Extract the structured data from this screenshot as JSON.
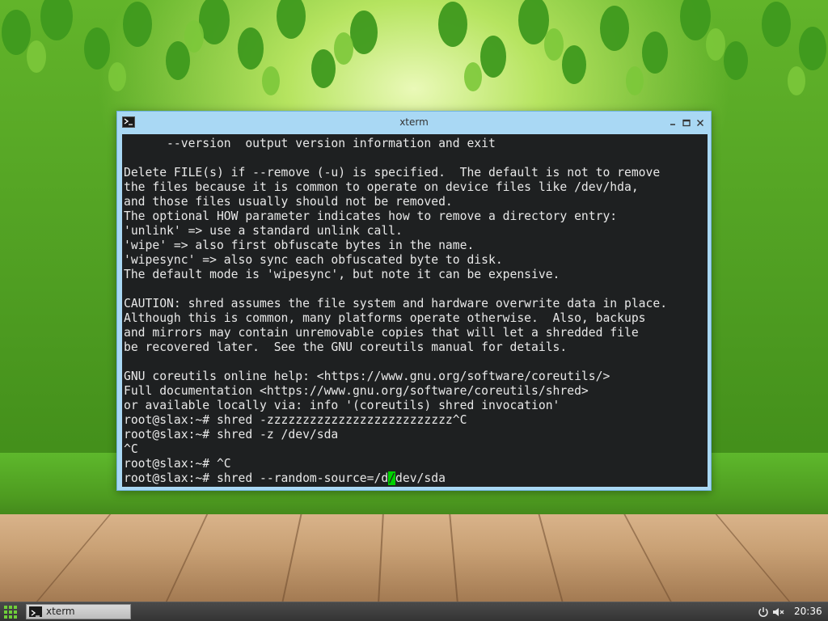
{
  "window": {
    "title": "xterm",
    "icon": "terminal-icon",
    "controls": [
      "minimize-icon",
      "maximize-icon",
      "close-icon"
    ]
  },
  "terminal": {
    "lines": [
      "      --version  output version information and exit",
      "",
      "Delete FILE(s) if --remove (-u) is specified.  The default is not to remove",
      "the files because it is common to operate on device files like /dev/hda,",
      "and those files usually should not be removed.",
      "The optional HOW parameter indicates how to remove a directory entry:",
      "'unlink' => use a standard unlink call.",
      "'wipe' => also first obfuscate bytes in the name.",
      "'wipesync' => also sync each obfuscated byte to disk.",
      "The default mode is 'wipesync', but note it can be expensive.",
      "",
      "CAUTION: shred assumes the file system and hardware overwrite data in place.",
      "Although this is common, many platforms operate otherwise.  Also, backups",
      "and mirrors may contain unremovable copies that will let a shredded file",
      "be recovered later.  See the GNU coreutils manual for details.",
      "",
      "GNU coreutils online help: <https://www.gnu.org/software/coreutils/>",
      "Full documentation <https://www.gnu.org/software/coreutils/shred>",
      "or available locally via: info '(coreutils) shred invocation'",
      "root@slax:~# shred -zzzzzzzzzzzzzzzzzzzzzzzzzz^C",
      "root@slax:~# shred -z /dev/sda",
      "^C",
      "root@slax:~# ^C"
    ],
    "prompt_line": {
      "before_cursor": "root@slax:~# shred --random-source=/d",
      "cursor_char": "/",
      "after_cursor": "dev/sda"
    },
    "colors": {
      "background": "#1e2021",
      "foreground": "#e8e8e8",
      "cursor": "#00d000"
    }
  },
  "taskbar": {
    "start_icon": "grid-menu-icon",
    "items": [
      {
        "label": "xterm",
        "icon": "terminal-icon"
      }
    ],
    "tray": [
      "power-icon",
      "volume-muted-icon"
    ],
    "clock": "20:36"
  },
  "colors": {
    "titlebar": "#a9d8f4",
    "taskbar": "#3a3a3a"
  }
}
